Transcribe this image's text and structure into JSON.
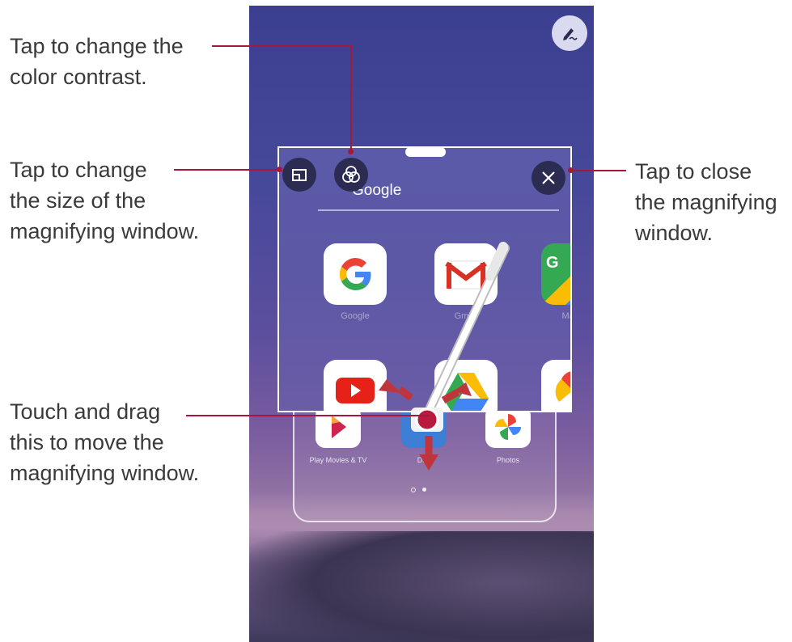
{
  "callouts": {
    "contrast": [
      "Tap to change the",
      "color contrast."
    ],
    "size": [
      "Tap to change",
      "the size of the",
      "magnifying window."
    ],
    "close": [
      "Tap to close",
      "the magnifying",
      "window."
    ],
    "move": [
      "Touch and drag",
      "this to move the",
      "magnifying window."
    ]
  },
  "magnifier": {
    "folder_title": "Google",
    "apps_row1": [
      {
        "label": "Google",
        "icon": "google-g-icon"
      },
      {
        "label": "Gmail",
        "icon": "gmail-icon"
      },
      {
        "label": "Maps",
        "icon": "maps-icon"
      }
    ],
    "apps_row2": [
      {
        "icon": "youtube-icon"
      },
      {
        "icon": "drive-icon"
      },
      {
        "icon": "photos-icon"
      }
    ],
    "buttons": [
      "resize-icon",
      "color-contrast-icon",
      "close-icon"
    ]
  },
  "background_apps": [
    {
      "label": "Play Movies & TV",
      "icon": "play-movies-icon"
    },
    {
      "label": "Duo",
      "icon": "duo-icon"
    },
    {
      "label": "Photos",
      "icon": "photos-icon"
    }
  ],
  "colors": {
    "leader": "#a3183d",
    "text": "#3a3a3a",
    "button_dark": "#2c2c52",
    "drag_arrow": "#c0353c"
  }
}
